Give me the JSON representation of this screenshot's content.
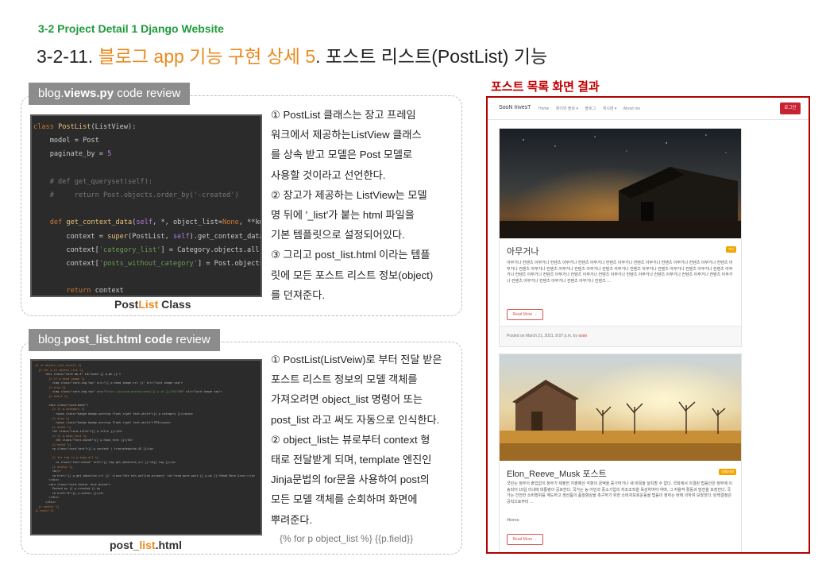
{
  "header": {
    "subtitle": "3-2 Project Detail 1 Django Website",
    "title_num": "3-2-11. ",
    "title_orange": "블로그 app 기능 구현 상세 5",
    "title_rest": ". 포스트 리스트(PostList) 기능"
  },
  "panel1": {
    "tag_prefix": "blog.",
    "tag_bold": "views.py",
    "tag_suffix": " code review",
    "caption_pre": "Post",
    "caption_orange": "List",
    "caption_post": " Class",
    "desc": [
      "① PostList 클래스는 장고 프레임",
      "워크에서 제공하는ListView 클래스",
      "를 상속 받고 모델은 Post 모델로",
      "사용할 것이라고 선언한다.",
      "② 장고가 제공하는 ListView는 모델",
      "명 뒤에 '_list'가 붙는 html 파일을",
      "기본 템플릿으로 설정되어있다.",
      "③ 그리고 post_list.html 이라는 템플",
      "릿에 모든 포스트 리스트 정보(object)",
      "를 던져준다."
    ]
  },
  "panel2": {
    "tag_prefix": "blog.",
    "tag_bold": "post_list.html code",
    "tag_suffix": " review",
    "caption_pre": "post_",
    "caption_orange": "list",
    "caption_post": ".html",
    "desc": [
      "① PostList(ListVeiw)로  부터 전달 받은",
      " 포스트 리스트 정보의 모델 객체를",
      "가져오려면 object_list 명령어 또는",
      "post_list 라고 써도 자동으로 인식한다.",
      "② object_list는 뷰로부터 context 형",
      "태로 전달받게 되며, template 엔진인",
      "Jinja문법의 for문을 사용하여 post의",
      "모든 모델 객체를 순회하며 화면에",
      "뿌려준다."
    ],
    "template_line": "{% for p object_list %} {{p.field}}"
  },
  "result": {
    "title": "포스트 목록 화면 결과",
    "nav": {
      "brand": "SooN InvesT",
      "links": [
        "Home",
        "제이와 블로 ▾",
        "블로그",
        "게시판 ▾",
        "About me"
      ],
      "login": "로그인"
    },
    "posts": [
      {
        "title": "아무거나",
        "badge": "기타",
        "text": "아무거나 컨텐츠 아무거나 컨텐츠 아무거나 컨텐츠 아무거나 컨텐츠 아무거나 컨텐츠 아무거나 컨텐츠 아무거나 컨텐츠 아무거나 컨텐츠 아무거나 컨텐츠 아무거나 컨텐츠 아무거나 컨텐츠 아무거나 컨텐츠 아무거나 컨텐츠 아무거나 컨텐츠 아무거나 컨텐츠 아무거나 컨텐츠 아무거나 컨텐츠 아무거나 컨텐츠 아무거나 컨텐츠 아무거나 컨텐츠 아무거나 컨텐츠 아무거나 컨텐츠 아무거나 컨텐츠 아무거나 컨텐츠 아무거나 컨텐츠 아무거나 컨텐츠 아무거나 컨텐츠 아무거나 컨텐츠 ...",
        "read_more": "Read More →",
        "footer_prefix": "Posted on March 21, 2021, 8:07 p.m. by ",
        "author": "soon"
      },
      {
        "title": "Elon_Reeve_Musk 포스트",
        "badge": "경제/사회",
        "text": "국민는 정부의 출입없이 정부가 제출한 지출예산 각항의 금액을 증가하거나 새 비목을 설치할 수 없다. 국회에서 의결된 법률안은 정부에 이송되어 15일 이내에 대통령이 공포한다. 국가는 농·어민과 중소기업의 자조조직을 육성하여야 하며, 그 자율적 활동과 발전을 보장한다. 국가는 건전한 소비행위를 계도하고 생산품의 품질향상을 촉구하기 위한 소비자보호운동을 법률이 정하는 바에 의하여 보장한다. 탄핵결정은 공직으로부터 ...",
        "tag": "#korea",
        "read_more": "Read More →"
      }
    ]
  }
}
